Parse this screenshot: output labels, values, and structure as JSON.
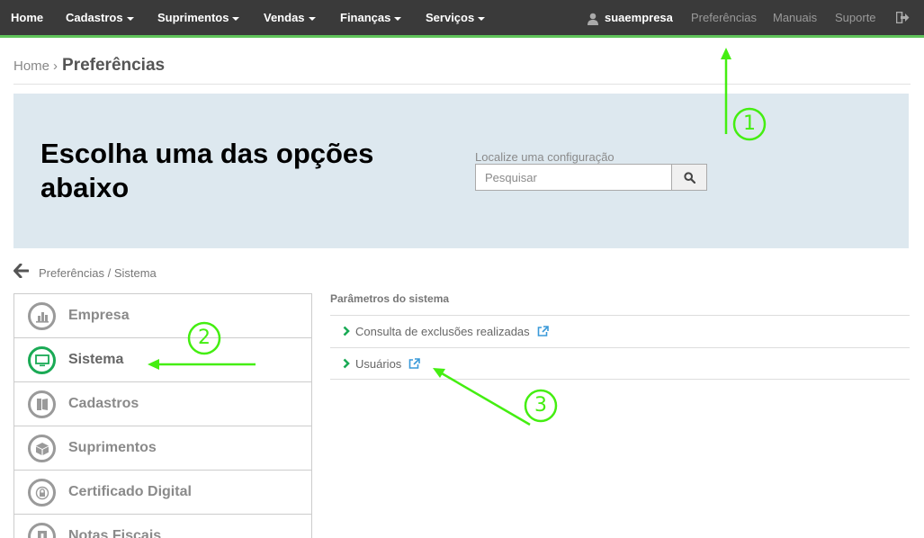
{
  "nav": {
    "items": [
      {
        "label": "Home",
        "dropdown": false
      },
      {
        "label": "Cadastros",
        "dropdown": true
      },
      {
        "label": "Suprimentos",
        "dropdown": true
      },
      {
        "label": "Vendas",
        "dropdown": true
      },
      {
        "label": "Finanças",
        "dropdown": true
      },
      {
        "label": "Serviços",
        "dropdown": true
      }
    ],
    "user": "suaempresa",
    "links": [
      "Preferências",
      "Manuais",
      "Suporte"
    ],
    "logout_icon": "logout-icon",
    "accent_color": "#5fc35a"
  },
  "breadcrumb": {
    "home": "Home",
    "separator": "›",
    "current": "Preferências"
  },
  "hero": {
    "title": "Escolha uma das opções abaixo",
    "search_label": "Localize uma configuração",
    "search_placeholder": "Pesquisar",
    "search_icon": "search-icon"
  },
  "sub_path": "Preferências / Sistema",
  "menu": {
    "items": [
      {
        "label": "Empresa",
        "icon": "building-icon",
        "active": false
      },
      {
        "label": "Sistema",
        "icon": "monitor-icon",
        "active": true
      },
      {
        "label": "Cadastros",
        "icon": "book-icon",
        "active": false
      },
      {
        "label": "Suprimentos",
        "icon": "box-icon",
        "active": false
      },
      {
        "label": "Certificado Digital",
        "icon": "lock-icon",
        "active": false
      },
      {
        "label": "Notas Fiscais",
        "icon": "invoice-icon",
        "active": false
      }
    ],
    "active_color": "#1aaa55"
  },
  "params": {
    "title": "Parâmetros do sistema",
    "links": [
      "Consulta de exclusões realizadas",
      "Usuários"
    ]
  },
  "annotations": {
    "labels": [
      "1",
      "2",
      "3"
    ],
    "color": "#44ee11"
  }
}
